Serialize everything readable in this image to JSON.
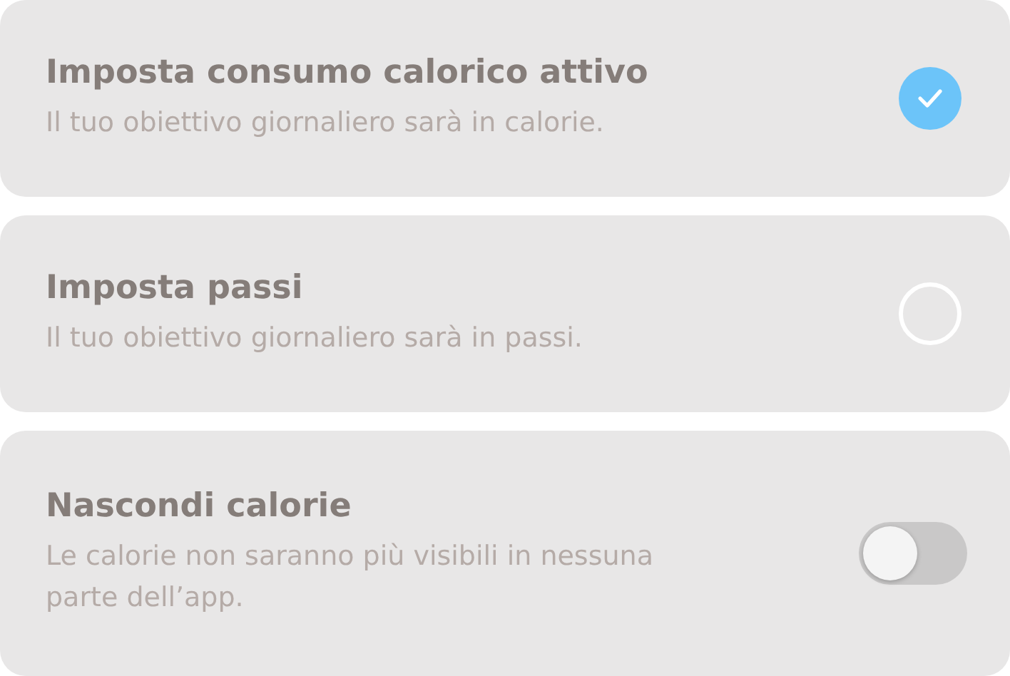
{
  "options": [
    {
      "kind": "radio",
      "title": "Imposta consumo calorico attivo",
      "description": "Il tuo obiettivo giornaliero sarà in calorie.",
      "selected": true
    },
    {
      "kind": "radio",
      "title": "Imposta passi",
      "description": "Il tuo obiettivo giornaliero sarà in passi.",
      "selected": false
    },
    {
      "kind": "toggle",
      "title": "Nascondi calorie",
      "description": "Le calorie non saranno più visibili in nessuna parte dell’app.",
      "on": false
    }
  ]
}
